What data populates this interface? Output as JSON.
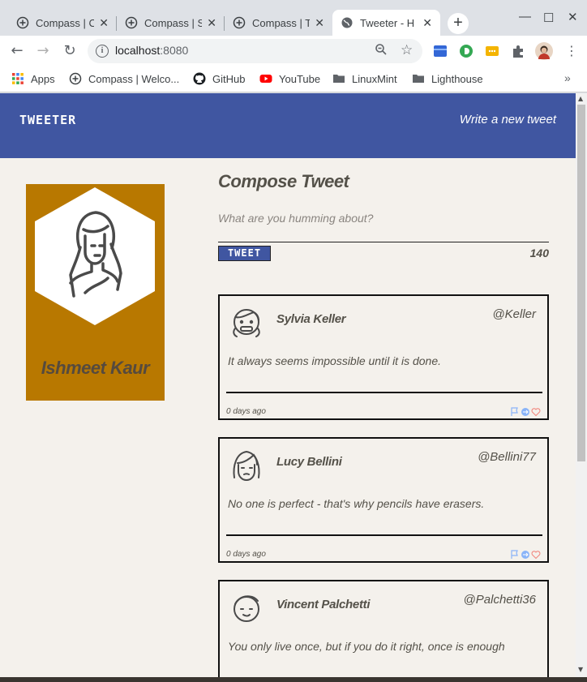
{
  "browser": {
    "tabs": [
      {
        "title": "Compass | C"
      },
      {
        "title": "Compass | S"
      },
      {
        "title": "Compass | T"
      },
      {
        "title": "Tweeter - H"
      }
    ],
    "url_host": "localhost",
    "url_port": ":8080",
    "bookmarks": [
      {
        "label": "Apps",
        "icon": "apps-grid-icon"
      },
      {
        "label": "Compass | Welco...",
        "icon": "compass-icon"
      },
      {
        "label": "GitHub",
        "icon": "github-icon"
      },
      {
        "label": "YouTube",
        "icon": "youtube-icon"
      },
      {
        "label": "LinuxMint",
        "icon": "folder-icon"
      },
      {
        "label": "Lighthouse",
        "icon": "folder-icon"
      }
    ]
  },
  "nav": {
    "brand": "TWEETER",
    "write_link": "Write a new tweet"
  },
  "profile": {
    "name": "Ishmeet Kaur"
  },
  "compose": {
    "heading": "Compose Tweet",
    "placeholder": "What are you humming about?",
    "button_label": "TWEET",
    "counter": "140"
  },
  "tweets": [
    {
      "name": "Sylvia Keller",
      "handle": "@Keller",
      "text": "It always seems impossible until it is done.",
      "age": "0 days ago"
    },
    {
      "name": "Lucy Bellini",
      "handle": "@Bellini77",
      "text": "No one is perfect - that's why pencils have erasers.",
      "age": "0 days ago"
    },
    {
      "name": "Vincent Palchetti",
      "handle": "@Palchetti36",
      "text": "You only live once, but if you do it right, once is enough",
      "age": ""
    }
  ],
  "colors": {
    "nav_bg": "#4056a1",
    "profile_bg": "#b87800",
    "page_bg": "#f4f1ec"
  }
}
